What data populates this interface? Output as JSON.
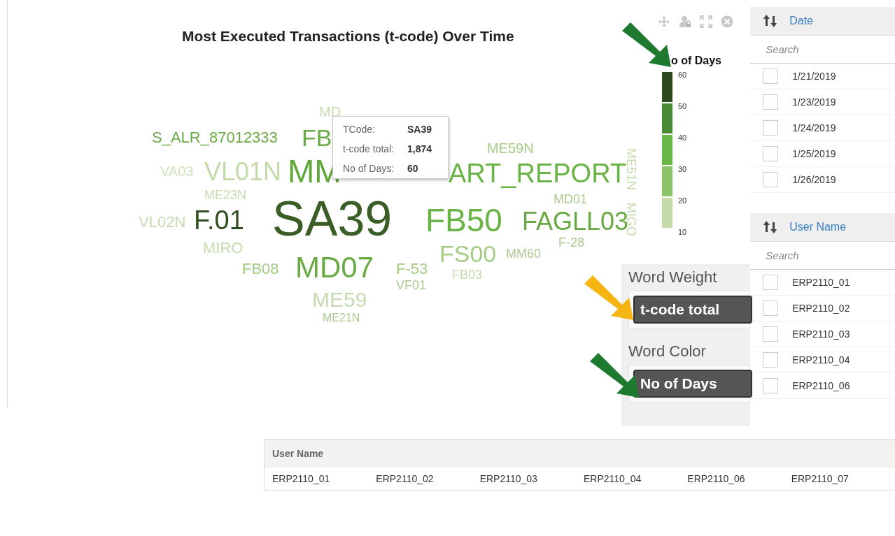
{
  "chart": {
    "title": "Most Executed Transactions (t-code) Over Time",
    "toolbar": [
      {
        "kind": "move"
      },
      {
        "kind": "lock"
      },
      {
        "kind": "expand"
      },
      {
        "kind": "close"
      }
    ],
    "words": [
      {
        "text": "MD",
        "color": "#c5dcb0"
      },
      {
        "text": "S_ALR_87012333",
        "color": "#6aaa45"
      },
      {
        "text": "FB",
        "color": "#6aaa45"
      },
      {
        "text": "ME59N",
        "color": "#a5cc85"
      },
      {
        "text": "VA03",
        "color": "#d0e3bf"
      },
      {
        "text": "VL01N",
        "color": "#c3dba8"
      },
      {
        "text": "MM",
        "color": "#5fa83a"
      },
      {
        "text": "ART_REPORT",
        "color": "#6ab446"
      },
      {
        "text": "ME23N",
        "color": "#c5dcb0"
      },
      {
        "text": "MD01",
        "color": "#a9c98c"
      },
      {
        "text": "VL02N",
        "color": "#c5dcb0"
      },
      {
        "text": "F.01",
        "color": "#2f4f20"
      },
      {
        "text": "SA39",
        "color": "#3a5e25"
      },
      {
        "text": "FB50",
        "color": "#6ab446"
      },
      {
        "text": "FAGLL03",
        "color": "#6aaa45"
      },
      {
        "text": "ME51N",
        "color": "#c5dcb0"
      },
      {
        "text": "MIGO",
        "color": "#c5dcb0"
      },
      {
        "text": "F-28",
        "color": "#abca90"
      },
      {
        "text": "MIRO",
        "color": "#c5dcb0"
      },
      {
        "text": "FS00",
        "color": "#a5cc85"
      },
      {
        "text": "MM60",
        "color": "#abca90"
      },
      {
        "text": "FB08",
        "color": "#a5cc85"
      },
      {
        "text": "MD07",
        "color": "#6aaa45"
      },
      {
        "text": "F-53",
        "color": "#a5cc85"
      },
      {
        "text": "FB03",
        "color": "#c5dcb0"
      },
      {
        "text": "VF01",
        "color": "#abca90"
      },
      {
        "text": "ME59",
        "color": "#c5dcb0"
      },
      {
        "text": "ME21N",
        "color": "#abca90"
      }
    ],
    "tooltip": {
      "rows": [
        {
          "label": "TCode:",
          "value": "SA39"
        },
        {
          "label": "t-code total:",
          "value": "1,874"
        },
        {
          "label": "No of Days:",
          "value": "60"
        }
      ]
    },
    "legend": {
      "title": "o of Days",
      "ticks": [
        "60",
        "50",
        "40",
        "30",
        "20",
        "10"
      ],
      "segments": [
        {
          "color": "#2d4a1e"
        },
        {
          "color": "#4a8a35"
        },
        {
          "color": "#6ab846"
        },
        {
          "color": "#8cc468"
        },
        {
          "color": "#c3dca8"
        }
      ]
    }
  },
  "settings": [
    {
      "label": "Word Weight",
      "value": "t-code total"
    },
    {
      "label": "Word Color",
      "value": "No of Days"
    }
  ],
  "annotations": [
    {
      "color": "#1e7a2e"
    },
    {
      "color": "#f5b512"
    },
    {
      "color": "#1e7a2e"
    }
  ],
  "filters": [
    {
      "header": "Date",
      "placeholder": "Search",
      "items": [
        {
          "label": "1/21/2019",
          "checked": false
        },
        {
          "label": "1/23/2019",
          "checked": false
        },
        {
          "label": "1/24/2019",
          "checked": false
        },
        {
          "label": "1/25/2019",
          "checked": false
        },
        {
          "label": "1/26/2019",
          "checked": false
        }
      ]
    },
    {
      "header": "User Name",
      "placeholder": "Search",
      "items": [
        {
          "label": "ERP2110_01",
          "checked": false
        },
        {
          "label": "ERP2110_02",
          "checked": false
        },
        {
          "label": "ERP2110_03",
          "checked": false
        },
        {
          "label": "ERP2110_04",
          "checked": false
        },
        {
          "label": "ERP2110_06",
          "checked": false
        }
      ]
    }
  ],
  "table": {
    "columns": [
      "User Name"
    ],
    "rows": [
      [
        "ERP2110_01",
        "ERP2110_02",
        "ERP2110_03",
        "ERP2110_04",
        "ERP2110_06",
        "ERP2110_07"
      ]
    ]
  }
}
